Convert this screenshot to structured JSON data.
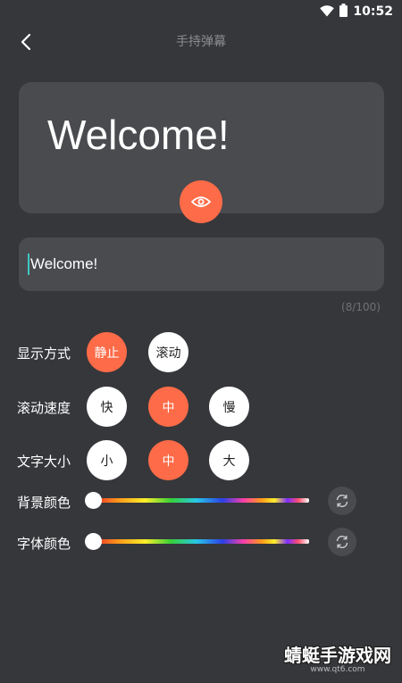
{
  "status_bar": {
    "time": "10:52"
  },
  "header": {
    "title": "手持弹幕"
  },
  "preview": {
    "text": "Welcome!"
  },
  "input": {
    "value": "Welcome!",
    "counter": "(8/100)"
  },
  "display_mode": {
    "label": "显示方式",
    "options": [
      "静止",
      "滚动"
    ],
    "selected": "静止"
  },
  "scroll_speed": {
    "label": "滚动速度",
    "options": [
      "快",
      "中",
      "慢"
    ],
    "selected": "中"
  },
  "text_size": {
    "label": "文字大小",
    "options": [
      "小",
      "中",
      "大"
    ],
    "selected": "中"
  },
  "background_color": {
    "label": "背景颜色"
  },
  "font_color": {
    "label": "字体颜色"
  },
  "colors": {
    "accent": "#fd6b48",
    "background": "#36373b",
    "card": "#4a4b4f"
  },
  "watermark": {
    "main": "蜻蜓手游戏网",
    "sub": "www.qt6.com"
  }
}
